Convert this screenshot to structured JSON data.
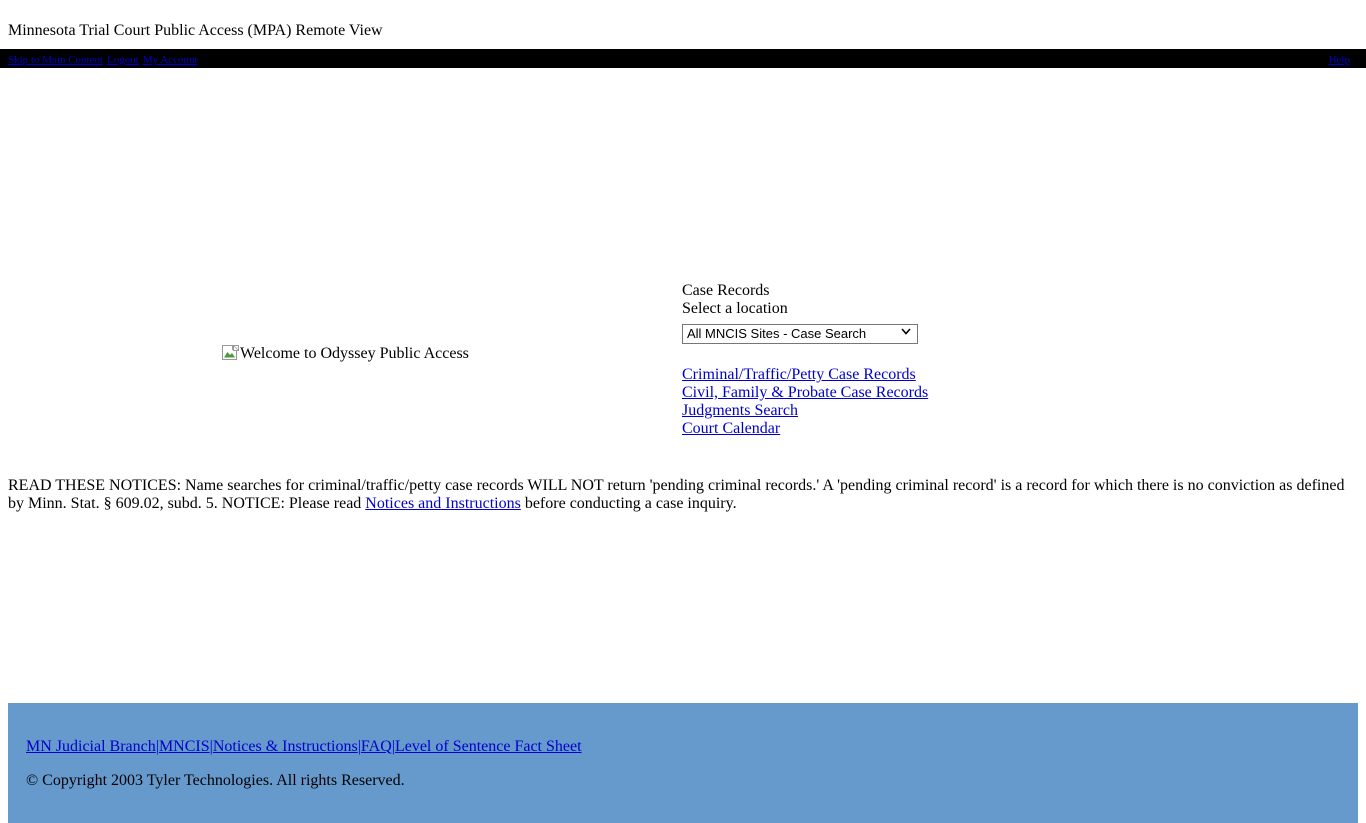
{
  "page": {
    "title": "Minnesota Trial Court Public Access (MPA) Remote View"
  },
  "topbar": {
    "skip_link": "Skip to Main Content",
    "logout_link": "Logout",
    "account_link": "My Account",
    "help_link": "Help",
    "background_color": "#000000",
    "link_color": "#0000cc"
  },
  "banner": {
    "image_alt": "Welcome to Odyssey Public Access",
    "image_icon": "broken-image-icon"
  },
  "case_records": {
    "heading": "Case Records",
    "select_label": "Select a location",
    "location_selected": "All MNCIS Sites - Case Search",
    "location_options": [
      "All MNCIS Sites - Case Search"
    ],
    "links": [
      "Criminal/Traffic/Petty Case Records",
      "Civil, Family & Probate Case Records",
      "Judgments Search",
      "Court Calendar"
    ]
  },
  "notices": {
    "text_before_link": "READ THESE NOTICES: Name searches for criminal/traffic/petty case records WILL NOT return 'pending criminal records.' A 'pending criminal record' is a record for which there is no conviction as defined by Minn. Stat. § 609.02, subd. 5. NOTICE: Please read ",
    "link_text": "Notices and Instructions",
    "text_after_link": " before conducting a case inquiry."
  },
  "footer": {
    "background_color": "#6699cc",
    "links": [
      "MN Judicial Branch",
      "MNCIS",
      "Notices & Instructions",
      "FAQ",
      "Level of Sentence Fact Sheet"
    ],
    "separator": "|",
    "copyright": "© Copyright 2003 Tyler Technologies. All rights Reserved."
  }
}
